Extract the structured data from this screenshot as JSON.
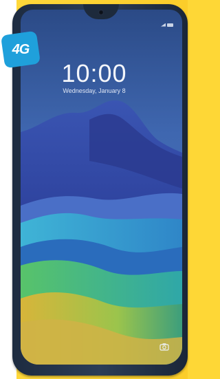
{
  "badge": {
    "label": "4G"
  },
  "lock_screen": {
    "time": "10:00",
    "date": "Wednesday, January 8"
  },
  "icons": [
    "camera-shortcut-icon",
    "signal-icon",
    "battery-icon"
  ],
  "colors": {
    "background": "#fed736",
    "phone_frame": "#2c3d56",
    "badge": "#1fa0db",
    "clock_text": "#f4f6fb"
  }
}
